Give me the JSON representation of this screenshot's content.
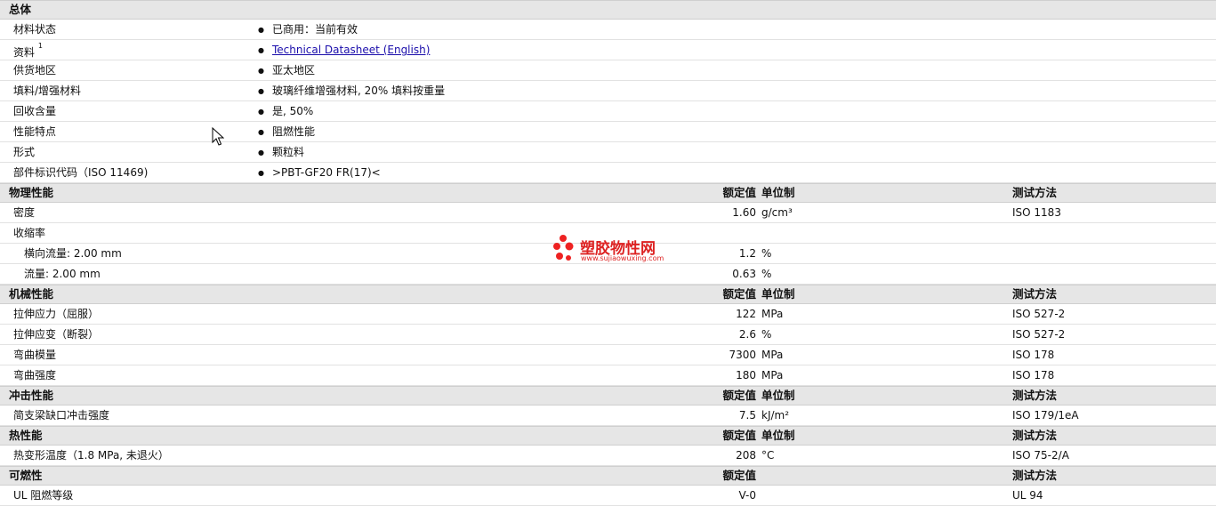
{
  "general": {
    "title": "总体",
    "rows": [
      {
        "label": "材料状态",
        "value": "已商用：当前有效"
      },
      {
        "label": "资料",
        "sup": "1",
        "link": "Technical Datasheet (English)"
      },
      {
        "label": "供货地区",
        "value": "亚太地区"
      },
      {
        "label": "填料/增强材料",
        "value": "玻璃纤维增强材料, 20% 填料按重量"
      },
      {
        "label": "回收含量",
        "value": "是, 50%"
      },
      {
        "label": "性能特点",
        "value": "阻燃性能"
      },
      {
        "label": "形式",
        "value": "颗粒料"
      },
      {
        "label": "部件标识代码（ISO 11469)",
        "value": ">PBT-GF20 FR(17)<"
      }
    ]
  },
  "physical": {
    "title": "物理性能",
    "h_value": "额定值",
    "h_unit": "单位制",
    "h_test": "测试方法",
    "rows": [
      {
        "label": "密度",
        "value": "1.60",
        "unit": "g/cm³",
        "test": "ISO 1183"
      },
      {
        "label": "收缩率",
        "value": "",
        "unit": "",
        "test": ""
      },
      {
        "label": "横向流量: 2.00 mm",
        "value": "1.2",
        "unit": "%",
        "test": "",
        "sub": true
      },
      {
        "label": "流量: 2.00 mm",
        "value": "0.63",
        "unit": "%",
        "test": "",
        "sub": true
      }
    ]
  },
  "mechanical": {
    "title": "机械性能",
    "h_value": "额定值",
    "h_unit": "单位制",
    "h_test": "测试方法",
    "rows": [
      {
        "label": "拉伸应力（屈服）",
        "value": "122",
        "unit": "MPa",
        "test": "ISO 527-2"
      },
      {
        "label": "拉伸应变（断裂）",
        "value": "2.6",
        "unit": "%",
        "test": "ISO 527-2"
      },
      {
        "label": "弯曲模量",
        "value": "7300",
        "unit": "MPa",
        "test": "ISO 178"
      },
      {
        "label": "弯曲强度",
        "value": "180",
        "unit": "MPa",
        "test": "ISO 178"
      }
    ]
  },
  "impact": {
    "title": "冲击性能",
    "h_value": "额定值",
    "h_unit": "单位制",
    "h_test": "测试方法",
    "rows": [
      {
        "label": "简支梁缺口冲击强度",
        "value": "7.5",
        "unit": "kJ/m²",
        "test": "ISO 179/1eA"
      }
    ]
  },
  "thermal": {
    "title": "热性能",
    "h_value": "额定值",
    "h_unit": "单位制",
    "h_test": "测试方法",
    "rows": [
      {
        "label": "热变形温度（1.8 MPa, 未退火）",
        "value": "208",
        "unit": "°C",
        "test": "ISO 75-2/A"
      }
    ]
  },
  "flammability": {
    "title": "可燃性",
    "h_value": "额定值",
    "h_unit": "",
    "h_test": "测试方法",
    "rows": [
      {
        "label": "UL 阻燃等级",
        "value": "V-0",
        "unit": "",
        "test": "UL 94"
      }
    ]
  },
  "watermark": {
    "name": "塑胶物性网",
    "url": "www.sujiaowuxing.com",
    "color": "#dd2222"
  },
  "icons": {
    "cursor": "mouse-pointer-icon",
    "bullet": "bullet-icon"
  }
}
